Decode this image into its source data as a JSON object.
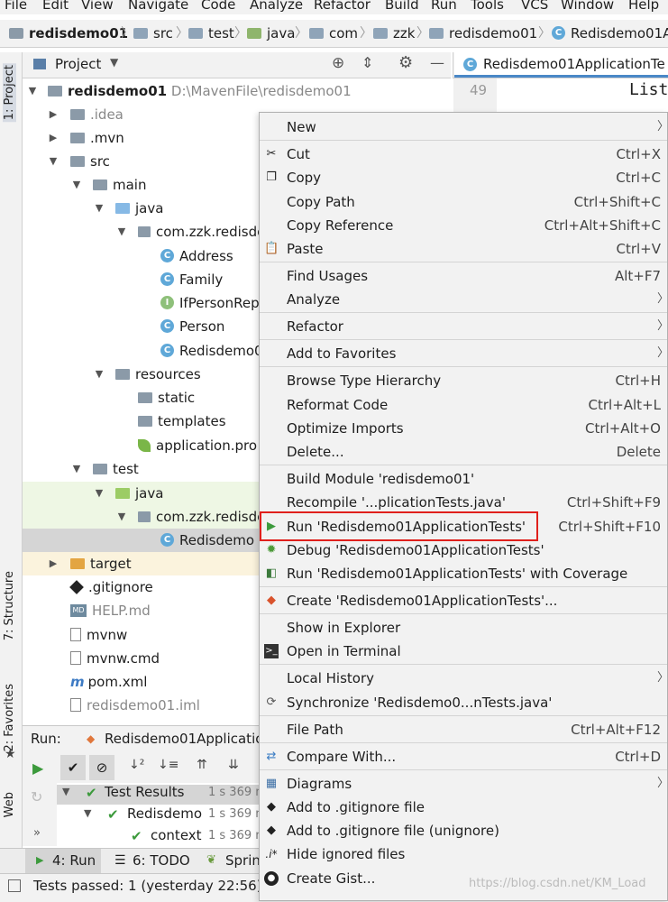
{
  "menubar": [
    "File",
    "Edit",
    "View",
    "Navigate",
    "Code",
    "Analyze",
    "Refactor",
    "Build",
    "Run",
    "Tools",
    "VCS",
    "Window",
    "Help"
  ],
  "breadcrumb": [
    "redisdemo01",
    "src",
    "test",
    "java",
    "com",
    "zzk",
    "redisdemo01",
    "Redisdemo01A"
  ],
  "toolstrip": {
    "project": "1: Project",
    "structure": "7: Structure",
    "favorites": "2: Favorites",
    "web": "Web"
  },
  "project_panel": {
    "title": "Project"
  },
  "editor": {
    "tab": "Redisdemo01ApplicationTe",
    "line_number": "49",
    "code": "List"
  },
  "tree": [
    {
      "label": "redisdemo01",
      "path": "D:\\MavenFile\\redisdemo01"
    },
    {
      "label": ".idea"
    },
    {
      "label": ".mvn"
    },
    {
      "label": "src"
    },
    {
      "label": "main"
    },
    {
      "label": "java"
    },
    {
      "label": "com.zzk.redisde"
    },
    {
      "label": "Address"
    },
    {
      "label": "Family"
    },
    {
      "label": "IfPersonRep"
    },
    {
      "label": "Person"
    },
    {
      "label": "Redisdemo0"
    },
    {
      "label": "resources"
    },
    {
      "label": "static"
    },
    {
      "label": "templates"
    },
    {
      "label": "application.pro"
    },
    {
      "label": "test"
    },
    {
      "label": "java"
    },
    {
      "label": "com.zzk.redisde"
    },
    {
      "label": "Redisdemo"
    },
    {
      "label": "target"
    },
    {
      "label": ".gitignore"
    },
    {
      "label": "HELP.md"
    },
    {
      "label": "mvnw"
    },
    {
      "label": "mvnw.cmd"
    },
    {
      "label": "pom.xml"
    },
    {
      "label": "redisdemo01.iml"
    }
  ],
  "run_panel": {
    "label": "Run:",
    "tab": "Redisdemo01Applicatio",
    "results": [
      {
        "label": "Test Results",
        "time": "1 s 369 m"
      },
      {
        "label": "Redisdemo",
        "time": "1 s 369 m"
      },
      {
        "label": "context",
        "time": "1 s 369 m"
      }
    ]
  },
  "bottom_tabs": {
    "run": "4: Run",
    "todo": "6: TODO",
    "spring": "Sprin"
  },
  "status": "Tests passed: 1 (yesterday 22:56)",
  "watermark": "https://blog.csdn.net/KM_Load",
  "context_menu": [
    {
      "label": "New",
      "submenu": true
    },
    {
      "label": "Cut",
      "shortcut": "Ctrl+X",
      "icon": "scissors-icon"
    },
    {
      "label": "Copy",
      "shortcut": "Ctrl+C",
      "icon": "copy-icon"
    },
    {
      "label": "Copy Path",
      "shortcut": "Ctrl+Shift+C"
    },
    {
      "label": "Copy Reference",
      "shortcut": "Ctrl+Alt+Shift+C"
    },
    {
      "label": "Paste",
      "shortcut": "Ctrl+V",
      "icon": "paste-icon"
    },
    {
      "label": "Find Usages",
      "shortcut": "Alt+F7"
    },
    {
      "label": "Analyze",
      "submenu": true
    },
    {
      "label": "Refactor",
      "submenu": true
    },
    {
      "label": "Add to Favorites",
      "submenu": true
    },
    {
      "label": "Browse Type Hierarchy",
      "shortcut": "Ctrl+H"
    },
    {
      "label": "Reformat Code",
      "shortcut": "Ctrl+Alt+L"
    },
    {
      "label": "Optimize Imports",
      "shortcut": "Ctrl+Alt+O"
    },
    {
      "label": "Delete...",
      "shortcut": "Delete"
    },
    {
      "label": "Build Module 'redisdemo01'"
    },
    {
      "label": "Recompile '...plicationTests.java'",
      "shortcut": "Ctrl+Shift+F9"
    },
    {
      "label": "Run 'Redisdemo01ApplicationTests'",
      "shortcut": "Ctrl+Shift+F10",
      "icon": "run-icon",
      "highlighted": true
    },
    {
      "label": "Debug 'Redisdemo01ApplicationTests'",
      "icon": "debug-icon"
    },
    {
      "label": "Run 'Redisdemo01ApplicationTests' with Coverage",
      "icon": "coverage-icon"
    },
    {
      "label": "Create 'Redisdemo01ApplicationTests'...",
      "icon": "create-config-icon"
    },
    {
      "label": "Show in Explorer"
    },
    {
      "label": "Open in Terminal",
      "icon": "terminal-icon"
    },
    {
      "label": "Local History",
      "submenu": true
    },
    {
      "label": "Synchronize 'Redisdemo0...nTests.java'",
      "icon": "sync-icon"
    },
    {
      "label": "File Path",
      "shortcut": "Ctrl+Alt+F12"
    },
    {
      "label": "Compare With...",
      "shortcut": "Ctrl+D",
      "icon": "compare-icon"
    },
    {
      "label": "Diagrams",
      "submenu": true,
      "icon": "diagram-icon"
    },
    {
      "label": "Add to .gitignore file",
      "icon": "gitignore-icon"
    },
    {
      "label": "Add to .gitignore file (unignore)",
      "icon": "gitignore-icon"
    },
    {
      "label": "Hide ignored files",
      "icon": "hide-ignored-icon"
    },
    {
      "label": "Create Gist...",
      "icon": "github-icon"
    }
  ]
}
